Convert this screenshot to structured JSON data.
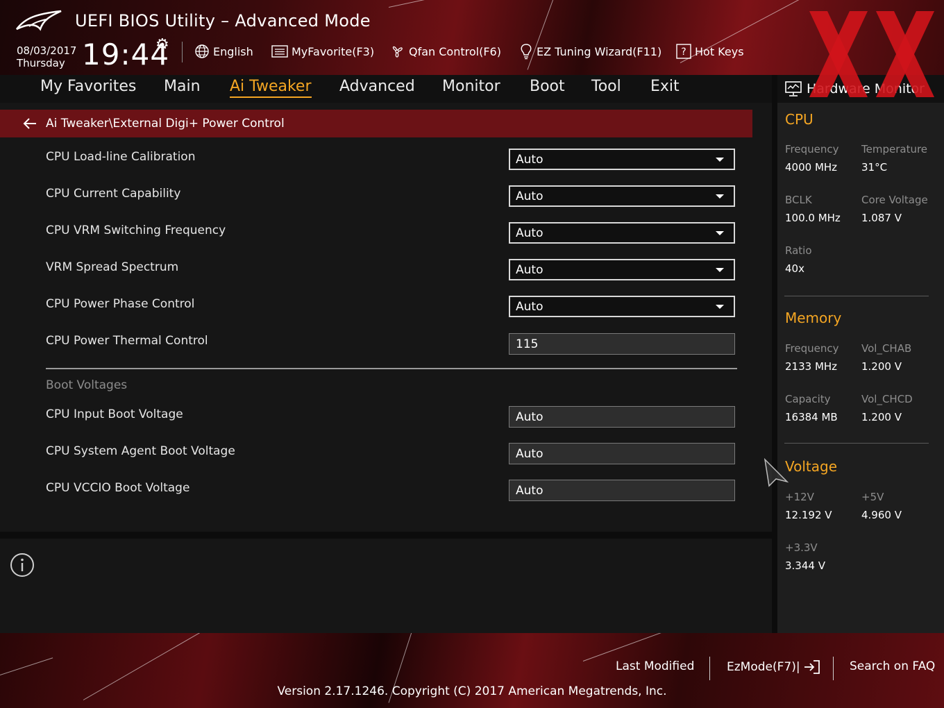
{
  "app": {
    "title": "UEFI BIOS Utility – Advanced Mode",
    "date": "08/03/2017",
    "day": "Thursday",
    "time": "19:44"
  },
  "toolbar": {
    "language": "English",
    "favorite": "MyFavorite(F3)",
    "qfan": "Qfan Control(F6)",
    "ez_tuning": "EZ Tuning Wizard(F11)",
    "hot_keys": "Hot Keys"
  },
  "tabs": [
    {
      "label": "My Favorites"
    },
    {
      "label": "Main"
    },
    {
      "label": "Ai Tweaker"
    },
    {
      "label": "Advanced"
    },
    {
      "label": "Monitor"
    },
    {
      "label": "Boot"
    },
    {
      "label": "Tool"
    },
    {
      "label": "Exit"
    }
  ],
  "active_tab": "Ai Tweaker",
  "breadcrumb": "Ai Tweaker\\External Digi+ Power Control",
  "settings": [
    {
      "label": "CPU Load-line Calibration",
      "value": "Auto"
    },
    {
      "label": "CPU Current Capability",
      "value": "Auto"
    },
    {
      "label": "CPU VRM Switching Frequency",
      "value": "Auto"
    },
    {
      "label": "VRM Spread Spectrum",
      "value": "Auto"
    },
    {
      "label": "CPU Power Phase Control",
      "value": "Auto"
    },
    {
      "label": "CPU Power Thermal Control",
      "value": "115"
    }
  ],
  "boot_section": {
    "title": "Boot Voltages",
    "items": [
      {
        "label": "CPU Input Boot Voltage",
        "value": "Auto"
      },
      {
        "label": "CPU System Agent Boot Voltage",
        "value": "Auto"
      },
      {
        "label": "CPU VCCIO Boot Voltage",
        "value": "Auto"
      }
    ]
  },
  "hw_monitor": {
    "title": "Hardware Monitor",
    "cpu": {
      "title": "CPU",
      "frequency_label": "Frequency",
      "frequency": "4000 MHz",
      "temperature_label": "Temperature",
      "temperature": "31°C",
      "bclk_label": "BCLK",
      "bclk": "100.0 MHz",
      "core_voltage_label": "Core Voltage",
      "core_voltage": "1.087 V",
      "ratio_label": "Ratio",
      "ratio": "40x"
    },
    "memory": {
      "title": "Memory",
      "frequency_label": "Frequency",
      "frequency": "2133 MHz",
      "vol_chab_label": "Vol_CHAB",
      "vol_chab": "1.200 V",
      "capacity_label": "Capacity",
      "capacity": "16384 MB",
      "vol_chcd_label": "Vol_CHCD",
      "vol_chcd": "1.200 V"
    },
    "voltage": {
      "title": "Voltage",
      "v12_label": "+12V",
      "v12": "12.192 V",
      "v5_label": "+5V",
      "v5": "4.960 V",
      "v33_label": "+3.3V",
      "v33": "3.344 V"
    }
  },
  "footer": {
    "last_modified": "Last Modified",
    "ezmode": "EzMode(F7)|",
    "search_faq": "Search on FAQ",
    "version": "Version 2.17.1246. Copyright (C) 2017 American Megatrends, Inc."
  },
  "colors": {
    "accent": "#f5a623",
    "breadcrumb_bg": "#6b1216",
    "brand_red": "#d0141b"
  }
}
